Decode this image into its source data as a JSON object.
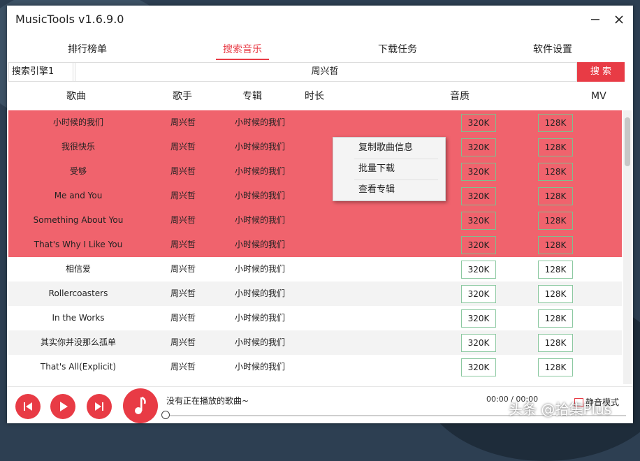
{
  "window": {
    "title": "MusicTools v1.6.9.0",
    "minimize_icon": "minimize-icon",
    "close_icon": "close-icon"
  },
  "tabs": [
    {
      "label": "排行榜单",
      "active": false
    },
    {
      "label": "搜索音乐",
      "active": true
    },
    {
      "label": "下载任务",
      "active": false
    },
    {
      "label": "软件设置",
      "active": false
    }
  ],
  "search": {
    "engine": "搜索引擎1",
    "query": "周兴哲",
    "button_label": "搜 索"
  },
  "columns": {
    "song": "歌曲",
    "singer": "歌手",
    "album": "专辑",
    "duration": "时长",
    "quality": "音质",
    "mv": "MV"
  },
  "songs": [
    {
      "title": "小时候的我们",
      "singer": "周兴哲",
      "album": "小时候的我们",
      "q1": "320K",
      "q2": "128K",
      "selected": true
    },
    {
      "title": "我很快乐",
      "singer": "周兴哲",
      "album": "小时候的我们",
      "q1": "320K",
      "q2": "128K",
      "selected": true
    },
    {
      "title": "受够",
      "singer": "周兴哲",
      "album": "小时候的我们",
      "q1": "320K",
      "q2": "128K",
      "selected": true
    },
    {
      "title": "Me and You",
      "singer": "周兴哲",
      "album": "小时候的我们",
      "q1": "320K",
      "q2": "128K",
      "selected": true
    },
    {
      "title": "Something About You",
      "singer": "周兴哲",
      "album": "小时候的我们",
      "q1": "320K",
      "q2": "128K",
      "selected": true
    },
    {
      "title": "That's Why I Like You",
      "singer": "周兴哲",
      "album": "小时候的我们",
      "q1": "320K",
      "q2": "128K",
      "selected": true
    },
    {
      "title": "相信爱",
      "singer": "周兴哲",
      "album": "小时候的我们",
      "q1": "320K",
      "q2": "128K",
      "selected": false
    },
    {
      "title": "Rollercoasters",
      "singer": "周兴哲",
      "album": "小时候的我们",
      "q1": "320K",
      "q2": "128K",
      "selected": false
    },
    {
      "title": "In the Works",
      "singer": "周兴哲",
      "album": "小时候的我们",
      "q1": "320K",
      "q2": "128K",
      "selected": false
    },
    {
      "title": "其实你并没那么孤单",
      "singer": "周兴哲",
      "album": "小时候的我们",
      "q1": "320K",
      "q2": "128K",
      "selected": false
    },
    {
      "title": "That's All(Explicit)",
      "singer": "周兴哲",
      "album": "小时候的我们",
      "q1": "320K",
      "q2": "128K",
      "selected": false
    }
  ],
  "context_menu": [
    "复制歌曲信息",
    "批量下载",
    "查看专辑"
  ],
  "player": {
    "now_playing": "没有正在播放的歌曲~",
    "time": "00:00 / 00:00",
    "mute_label": "静音模式",
    "mute_checked": false,
    "progress_fraction": 0,
    "icons": [
      "prev-icon",
      "play-icon",
      "next-icon",
      "music-note-icon"
    ]
  },
  "watermark": "头条 @拾集Plus",
  "colors": {
    "accent": "#e83b45",
    "selected_row": "#f0636d",
    "quality_border": "#8bc8a0"
  }
}
